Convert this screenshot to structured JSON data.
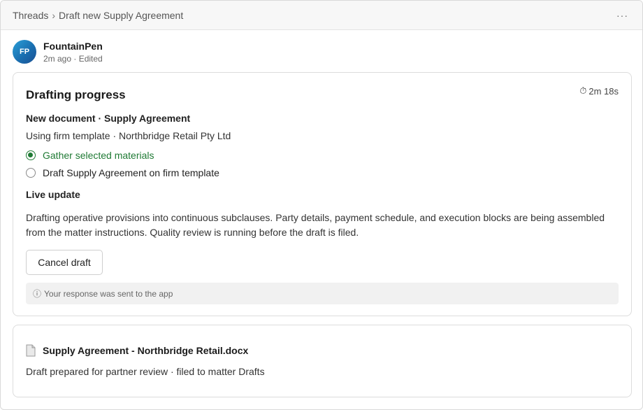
{
  "breadcrumb": {
    "root": "Threads",
    "separator": "›",
    "current": "Draft new Supply Agreement"
  },
  "menu": {
    "more_label": "···"
  },
  "author": {
    "initials": "FP",
    "name": "FountainPen",
    "meta": "2m ago · Edited"
  },
  "progress": {
    "title": "Drafting progress",
    "timer_icon": "⏱",
    "timer": "2m 18s",
    "doc_heading": "New document · Supply Agreement",
    "doc_sub": "Using firm template · Northbridge Retail Pty Ltd",
    "steps": [
      {
        "label": "Gather selected materials",
        "done": true
      },
      {
        "label": "Draft Supply Agreement on firm template",
        "done": false
      }
    ],
    "live_heading": "Live update",
    "live_text": "Drafting operative provisions into continuous subclauses. Party details, payment schedule, and execution blocks are being assembled from the matter instructions. Quality review is running before the draft is filed.",
    "cancel_label": "Cancel draft",
    "notice_icon": "ⓘ",
    "notice": "Your response was sent to the app"
  },
  "file": {
    "name": "Supply Agreement - Northbridge Retail.docx",
    "description": "Draft prepared for partner review · filed to matter Drafts"
  },
  "colors": {
    "accent_green": "#1f7a34",
    "avatar_blue": "#1a6fb0"
  }
}
